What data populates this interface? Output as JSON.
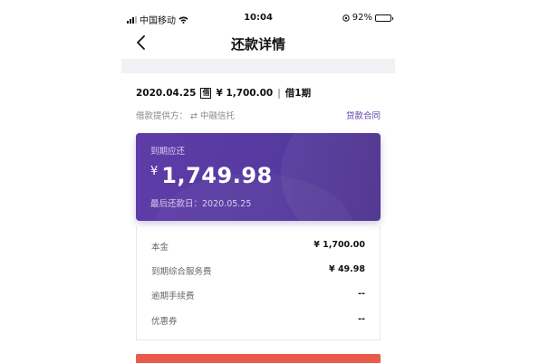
{
  "status_bar": {
    "carrier": "中国移动",
    "time": "10:04",
    "battery_percent": "92%",
    "battery_level": 0.92
  },
  "nav": {
    "back_icon": "chevron-left-icon",
    "title": "还款详情"
  },
  "loan": {
    "date": "2020.04.25",
    "type_badge": "借",
    "amount": "¥ 1,700.00",
    "separator": "|",
    "term": "借1期",
    "provider_label": "借款提供方：",
    "provider_arrow": "⇄",
    "provider_name": "中融信托",
    "contract_link": "贷款合同"
  },
  "due_card": {
    "label": "到期应还",
    "currency": "¥",
    "amount": "1,749.98",
    "last_date_label": "最后还款日：2020.05.25"
  },
  "breakdown": {
    "rows": [
      {
        "label": "本金",
        "value": "¥ 1,700.00"
      },
      {
        "label": "到期综合服务费",
        "value": "¥ 49.98"
      },
      {
        "label": "逾期手续费",
        "value": "--"
      },
      {
        "label": "优惠券",
        "value": "--"
      }
    ]
  },
  "colors": {
    "accent_purple": "#5b3fa8",
    "card_gradient_start": "#5e3ca8",
    "card_gradient_end": "#4a2f8c",
    "button_red": "#ea5a4a",
    "battery_yellow": "#f6c02c"
  }
}
